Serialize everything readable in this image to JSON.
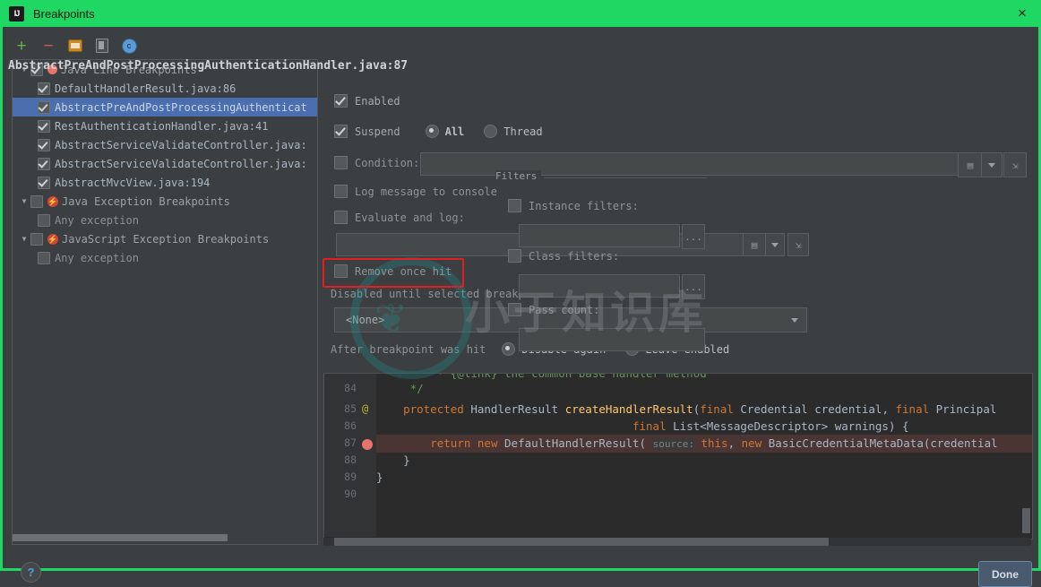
{
  "window": {
    "title": "Breakpoints",
    "logo_text": "IJ",
    "close_icon": "×",
    "titlebar_color": "#1fd763"
  },
  "toolbar": {
    "add_label": "+",
    "remove_label": "−",
    "group_icon": "folder-icon",
    "copy_icon": "document-icon",
    "muted_icon": "c"
  },
  "tree": {
    "groups": [
      {
        "label": "Java Line Breakpoints",
        "expanded": true,
        "checked": true,
        "icon": "breakpoint-dot",
        "items": [
          {
            "label": "DefaultHandlerResult.java:86",
            "checked": true,
            "selected": false
          },
          {
            "label": "AbstractPreAndPostProcessingAuthenticat",
            "checked": true,
            "selected": true
          },
          {
            "label": "RestAuthenticationHandler.java:41",
            "checked": true,
            "selected": false
          },
          {
            "label": "AbstractServiceValidateController.java:",
            "checked": true,
            "selected": false
          },
          {
            "label": "AbstractServiceValidateController.java:",
            "checked": true,
            "selected": false
          },
          {
            "label": "AbstractMvcView.java:194",
            "checked": true,
            "selected": false
          }
        ]
      },
      {
        "label": "Java Exception Breakpoints",
        "expanded": true,
        "checked": false,
        "icon": "exception-icon",
        "items": [
          {
            "label": "Any exception",
            "checked": false,
            "selected": false
          }
        ]
      },
      {
        "label": "JavaScript Exception Breakpoints",
        "expanded": true,
        "checked": false,
        "icon": "exception-icon",
        "items": [
          {
            "label": "Any exception",
            "checked": false,
            "selected": false
          }
        ]
      }
    ]
  },
  "details": {
    "title": "AbstractPreAndPostProcessingAuthenticationHandler.java:87",
    "enabled": {
      "label": "Enabled",
      "checked": true
    },
    "suspend": {
      "label": "Suspend",
      "checked": true
    },
    "suspend_all": {
      "label": "All",
      "selected": true
    },
    "suspend_thread": {
      "label": "Thread",
      "selected": false
    },
    "condition": {
      "label": "Condition:",
      "checked": false,
      "value": "",
      "placeholder": ""
    },
    "log_message": {
      "label": "Log message to console",
      "checked": false
    },
    "evaluate_and_log": {
      "label": "Evaluate and log:",
      "checked": false,
      "value": "",
      "placeholder": ""
    },
    "remove_once_hit": {
      "label": "Remove once hit",
      "checked": false,
      "highlighted": true
    },
    "disabled_until_label": "Disabled until selected breakpoint is hit:",
    "disabled_until_value": "<None>",
    "after_hit_label": "After breakpoint was hit",
    "after_hit_disable": {
      "label": "Disable again",
      "selected": true
    },
    "after_hit_leave": {
      "label": "Leave enabled",
      "selected": false
    }
  },
  "filters": {
    "legend": "Filters",
    "instance": {
      "label": "Instance filters:",
      "checked": false,
      "value": "",
      "more_label": "..."
    },
    "class": {
      "label": "Class filters:",
      "checked": false,
      "value": "",
      "more_label": "..."
    },
    "pass_count": {
      "label": "Pass count:",
      "checked": false,
      "value": ""
    }
  },
  "code_preview": {
    "lines": [
      {
        "num": "84",
        "text": "     */",
        "marker": "",
        "highlight": false
      },
      {
        "num": "85",
        "text": "    protected HandlerResult createHandlerResult(final Credential credential, final Principal",
        "marker": "@",
        "highlight": false
      },
      {
        "num": "86",
        "text": "                                      final List<MessageDescriptor> warnings) {",
        "marker": "",
        "highlight": false
      },
      {
        "num": "87",
        "text": "        return new DefaultHandlerResult( source: this, new BasicCredentialMetaData(credential",
        "marker": "breakpoint",
        "highlight": true
      },
      {
        "num": "88",
        "text": "    }",
        "marker": "",
        "highlight": false
      },
      {
        "num": "89",
        "text": "}",
        "marker": "",
        "highlight": false
      },
      {
        "num": "90",
        "text": "",
        "marker": "",
        "highlight": false
      }
    ]
  },
  "footer": {
    "help_label": "?",
    "done_label": "Done"
  },
  "watermark": {
    "text": "小于知识库",
    "sub": "",
    "deer_glyph": "❦"
  },
  "colors": {
    "accent_green": "#1fd763",
    "selection_blue": "#4b6eaf",
    "highlight_red": "#e02020",
    "breakpoint_red": "#e9736a"
  }
}
